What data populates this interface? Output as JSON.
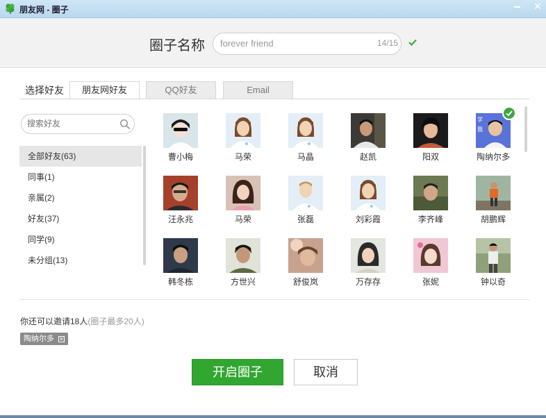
{
  "window": {
    "title": "朋友网 - 圈子"
  },
  "header": {
    "label": "圈子名称",
    "name_value": "forever friend",
    "char_count": "14/15"
  },
  "select_label": "选择好友",
  "tabs": [
    {
      "label": "朋友网好友"
    },
    {
      "label": "QQ好友"
    },
    {
      "label": "Email"
    }
  ],
  "search": {
    "placeholder": "搜索好友"
  },
  "groups": [
    {
      "label": "全部好友(63)"
    },
    {
      "label": "同事(1)"
    },
    {
      "label": "亲属(2)"
    },
    {
      "label": "好友(37)"
    },
    {
      "label": "同学(9)"
    },
    {
      "label": "未分组(13)"
    }
  ],
  "friends": [
    {
      "name": "曹小梅",
      "avatar": "photo-sunglasses"
    },
    {
      "name": "马荣",
      "avatar": "default-female"
    },
    {
      "name": "马晶",
      "avatar": "default-female"
    },
    {
      "name": "赵凯",
      "avatar": "photo-man-dark"
    },
    {
      "name": "阳双",
      "avatar": "photo-girl"
    },
    {
      "name": "陶纳尔多",
      "avatar": "photo-cartoon",
      "selected": true
    },
    {
      "name": "汪永兆",
      "avatar": "photo-man-red"
    },
    {
      "name": "马荣",
      "avatar": "photo-girl-smile"
    },
    {
      "name": "张磊",
      "avatar": "default-male"
    },
    {
      "name": "刘彩霞",
      "avatar": "default-female"
    },
    {
      "name": "李齐峰",
      "avatar": "photo-outdoor"
    },
    {
      "name": "胡鹏辉",
      "avatar": "photo-orange"
    },
    {
      "name": "韩冬栋",
      "avatar": "photo-boy"
    },
    {
      "name": "方世兴",
      "avatar": "photo-boy-light"
    },
    {
      "name": "舒俊岚",
      "avatar": "photo-blur"
    },
    {
      "name": "万存存",
      "avatar": "photo-girl-light"
    },
    {
      "name": "张妮",
      "avatar": "photo-pink"
    },
    {
      "name": "钟以奇",
      "avatar": "photo-standing"
    }
  ],
  "invite": {
    "text": "你还可以邀请18人",
    "note": "(圈子最多20人)"
  },
  "selected_chips": [
    {
      "label": "陶纳尔多"
    }
  ],
  "buttons": {
    "primary": "开启圈子",
    "secondary": "取消"
  },
  "colors": {
    "accent_green": "#31a631",
    "titlebar": "#c4def2"
  },
  "icons": [
    "clover-logo-icon",
    "minimize-icon",
    "close-icon",
    "check-icon",
    "search-icon",
    "remove-icon"
  ]
}
